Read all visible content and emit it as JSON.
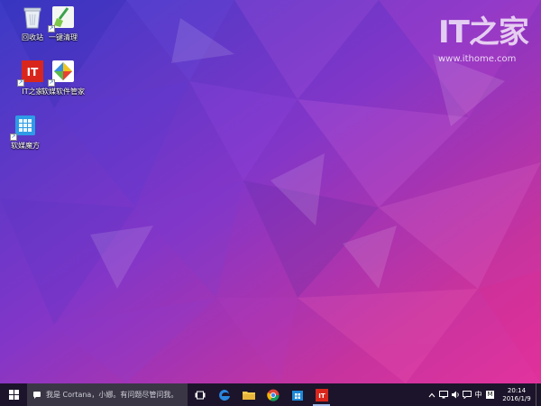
{
  "watermark": {
    "logo": "IT之家",
    "url": "www.ithome.com"
  },
  "desktop": {
    "icons": [
      {
        "name": "recycle-bin",
        "label": "回收站",
        "icon": "recycle-bin-icon"
      },
      {
        "name": "one-click-clean",
        "label": "一键清理",
        "icon": "broom-icon"
      },
      {
        "name": "ithome",
        "label": "IT之家",
        "icon": "ithome-icon"
      },
      {
        "name": "softmedia-manager",
        "label": "软媒软件管家",
        "icon": "software-manager-icon"
      },
      {
        "name": "softmedia-magic-cube",
        "label": "软媒魔方",
        "icon": "magic-cube-icon"
      }
    ]
  },
  "taskbar": {
    "search_placeholder": "我是 Cortana，小娜。有问题尽管问我。",
    "pinned_apps": [
      "task-view",
      "edge",
      "file-explorer",
      "chrome",
      "windows-store",
      "ithome"
    ],
    "tray": {
      "input_method": "中",
      "ime_mode": "M"
    },
    "clock": {
      "time": "20:14",
      "date": "2016/1/9"
    }
  },
  "colors": {
    "wallpaper_start": "#3d3cc8",
    "wallpaper_mid": "#8a35c9",
    "wallpaper_end": "#e2339e",
    "taskbar": "#14101c",
    "ithome_red": "#d9261c"
  }
}
